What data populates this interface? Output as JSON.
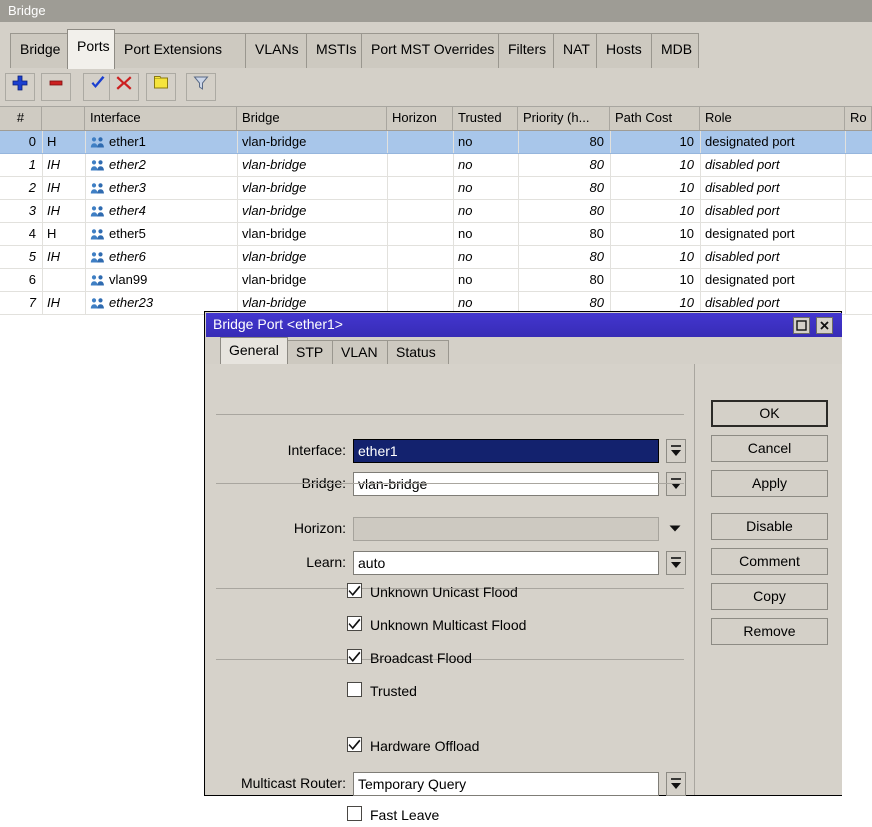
{
  "window": {
    "title": "Bridge",
    "tabs": [
      {
        "label": "Bridge",
        "active": false
      },
      {
        "label": "Ports",
        "active": true
      },
      {
        "label": "Port Extensions",
        "active": false
      },
      {
        "label": "VLANs",
        "active": false
      },
      {
        "label": "MSTIs",
        "active": false
      },
      {
        "label": "Port MST Overrides",
        "active": false
      },
      {
        "label": "Filters",
        "active": false
      },
      {
        "label": "NAT",
        "active": false
      },
      {
        "label": "Hosts",
        "active": false
      },
      {
        "label": "MDB",
        "active": false
      }
    ],
    "toolbar": [
      {
        "name": "add-button",
        "icon": "plus-icon",
        "title": "Add"
      },
      {
        "name": "remove-button",
        "icon": "minus-icon",
        "title": "Remove"
      },
      {
        "name": "enable-button",
        "icon": "check-icon",
        "title": "Enable"
      },
      {
        "name": "disable-button",
        "icon": "cross-icon",
        "title": "Disable"
      },
      {
        "name": "comment-button",
        "icon": "note-icon",
        "title": "Comment"
      },
      {
        "name": "filter-button",
        "icon": "funnel-icon",
        "title": "Filter"
      }
    ]
  },
  "table": {
    "columns": [
      {
        "key": "num",
        "label": "#"
      },
      {
        "key": "flags",
        "label": ""
      },
      {
        "key": "interface",
        "label": "Interface"
      },
      {
        "key": "bridge",
        "label": "Bridge"
      },
      {
        "key": "horizon",
        "label": "Horizon"
      },
      {
        "key": "trusted",
        "label": "Trusted"
      },
      {
        "key": "priority",
        "label": "Priority (h..."
      },
      {
        "key": "pathcost",
        "label": "Path Cost"
      },
      {
        "key": "role",
        "label": "Role"
      },
      {
        "key": "root",
        "label": "Ro"
      }
    ],
    "rows": [
      {
        "num": "0",
        "flags": "H",
        "interface": "ether1",
        "bridge": "vlan-bridge",
        "horizon": "",
        "trusted": "no",
        "priority": "80",
        "pathcost": "10",
        "role": "designated port",
        "selected": true,
        "italic": false
      },
      {
        "num": "1",
        "flags": "IH",
        "interface": "ether2",
        "bridge": "vlan-bridge",
        "horizon": "",
        "trusted": "no",
        "priority": "80",
        "pathcost": "10",
        "role": "disabled port",
        "selected": false,
        "italic": true
      },
      {
        "num": "2",
        "flags": "IH",
        "interface": "ether3",
        "bridge": "vlan-bridge",
        "horizon": "",
        "trusted": "no",
        "priority": "80",
        "pathcost": "10",
        "role": "disabled port",
        "selected": false,
        "italic": true
      },
      {
        "num": "3",
        "flags": "IH",
        "interface": "ether4",
        "bridge": "vlan-bridge",
        "horizon": "",
        "trusted": "no",
        "priority": "80",
        "pathcost": "10",
        "role": "disabled port",
        "selected": false,
        "italic": true
      },
      {
        "num": "4",
        "flags": "H",
        "interface": "ether5",
        "bridge": "vlan-bridge",
        "horizon": "",
        "trusted": "no",
        "priority": "80",
        "pathcost": "10",
        "role": "designated port",
        "selected": false,
        "italic": false
      },
      {
        "num": "5",
        "flags": "IH",
        "interface": "ether6",
        "bridge": "vlan-bridge",
        "horizon": "",
        "trusted": "no",
        "priority": "80",
        "pathcost": "10",
        "role": "disabled port",
        "selected": false,
        "italic": true
      },
      {
        "num": "6",
        "flags": "",
        "interface": "vlan99",
        "bridge": "vlan-bridge",
        "horizon": "",
        "trusted": "no",
        "priority": "80",
        "pathcost": "10",
        "role": "designated port",
        "selected": false,
        "italic": false
      },
      {
        "num": "7",
        "flags": "IH",
        "interface": "ether23",
        "bridge": "vlan-bridge",
        "horizon": "",
        "trusted": "no",
        "priority": "80",
        "pathcost": "10",
        "role": "disabled port",
        "selected": false,
        "italic": true
      }
    ]
  },
  "dialog": {
    "title": "Bridge Port <ether1>",
    "tabs": [
      {
        "label": "General",
        "active": true
      },
      {
        "label": "STP",
        "active": false
      },
      {
        "label": "VLAN",
        "active": false
      },
      {
        "label": "Status",
        "active": false
      }
    ],
    "fields": [
      {
        "label": "Interface:",
        "value": "ether1",
        "focused": true,
        "disabled": false,
        "control": "spinner"
      },
      {
        "label": "Bridge:",
        "value": "vlan-bridge",
        "focused": false,
        "disabled": false,
        "control": "spinner"
      },
      {
        "label": "Horizon:",
        "value": "",
        "focused": false,
        "disabled": true,
        "control": "chevron"
      },
      {
        "label": "Learn:",
        "value": "auto",
        "focused": false,
        "disabled": false,
        "control": "spinner"
      },
      {
        "label": "Multicast Router:",
        "value": "Temporary Query",
        "focused": false,
        "disabled": false,
        "control": "spinner"
      }
    ],
    "checkboxes": [
      {
        "label": "Unknown Unicast Flood",
        "checked": true
      },
      {
        "label": "Unknown Multicast Flood",
        "checked": true
      },
      {
        "label": "Broadcast Flood",
        "checked": true
      },
      {
        "label": "Trusted",
        "checked": false
      },
      {
        "label": "Hardware Offload",
        "checked": true
      },
      {
        "label": "Fast Leave",
        "checked": false
      }
    ],
    "buttons": [
      {
        "label": "OK",
        "primary": true
      },
      {
        "label": "Cancel",
        "primary": false
      },
      {
        "label": "Apply",
        "primary": false
      },
      {
        "label": "Disable",
        "primary": false
      },
      {
        "label": "Comment",
        "primary": false
      },
      {
        "label": "Copy",
        "primary": false
      },
      {
        "label": "Remove",
        "primary": false
      }
    ],
    "sysbuttons": [
      {
        "name": "maximize-button",
        "icon": "maximize-icon"
      },
      {
        "name": "close-button",
        "icon": "close-icon"
      }
    ]
  },
  "colors": {
    "selection": "#a8c6ea",
    "dialog_title": "#3c31c4",
    "focus_field": "#13226e",
    "chrome": "#d4d0c8"
  }
}
